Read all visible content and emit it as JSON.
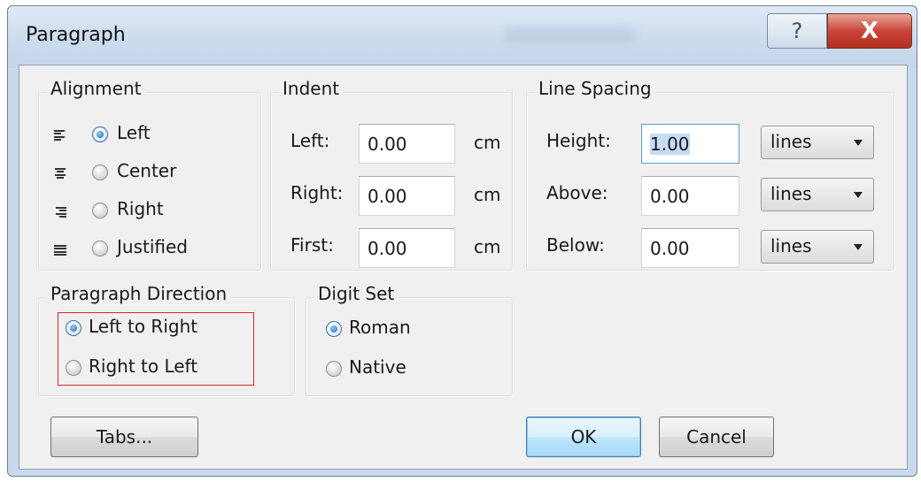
{
  "dialog": {
    "title": "Paragraph"
  },
  "title_buttons": {
    "help_glyph": "?",
    "close_glyph": "X"
  },
  "alignment": {
    "legend": "Alignment",
    "options": [
      {
        "label": "Left",
        "checked": true,
        "icon": "align-left-icon"
      },
      {
        "label": "Center",
        "checked": false,
        "icon": "align-center-icon"
      },
      {
        "label": "Right",
        "checked": false,
        "icon": "align-right-icon"
      },
      {
        "label": "Justified",
        "checked": false,
        "icon": "align-justify-icon"
      }
    ]
  },
  "indent": {
    "legend": "Indent",
    "rows": [
      {
        "label": "Left:",
        "value": "0.00",
        "unit": "cm"
      },
      {
        "label": "Right:",
        "value": "0.00",
        "unit": "cm"
      },
      {
        "label": "First:",
        "value": "0.00",
        "unit": "cm"
      }
    ]
  },
  "line_spacing": {
    "legend": "Line Spacing",
    "rows": [
      {
        "label": "Height:",
        "value": "1.00",
        "unit": "lines",
        "focused": true
      },
      {
        "label": "Above:",
        "value": "0.00",
        "unit": "lines"
      },
      {
        "label": "Below:",
        "value": "0.00",
        "unit": "lines"
      }
    ]
  },
  "paragraph_direction": {
    "legend": "Paragraph Direction",
    "options": [
      {
        "label": "Left to Right",
        "checked": true
      },
      {
        "label": "Right to Left",
        "checked": false
      }
    ]
  },
  "digit_set": {
    "legend": "Digit Set",
    "options": [
      {
        "label": "Roman",
        "checked": true
      },
      {
        "label": "Native",
        "checked": false
      }
    ]
  },
  "buttons": {
    "tabs": "Tabs...",
    "ok": "OK",
    "cancel": "Cancel"
  },
  "colors": {
    "highlight_box": "#d9262a",
    "radio_selected": "#1c5fb4",
    "close_button": "#c9453a",
    "focus_border": "#569de5"
  }
}
